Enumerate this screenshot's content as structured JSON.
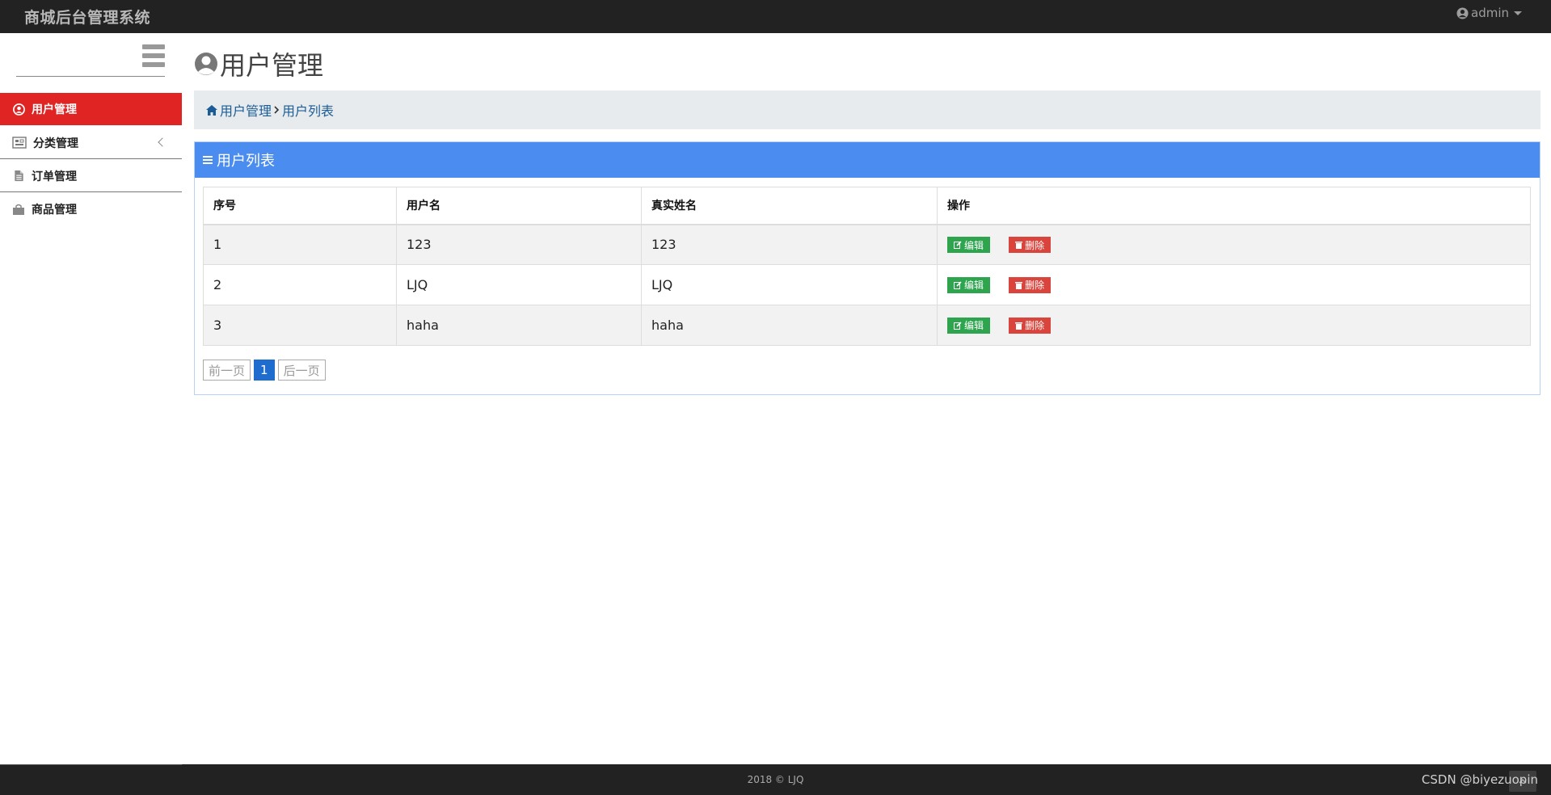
{
  "app": {
    "brand": "商城后台管理系统",
    "user": "admin"
  },
  "sidebar": {
    "items": [
      {
        "label": "用户管理",
        "icon": "user-circle-icon",
        "active": true
      },
      {
        "label": "分类管理",
        "icon": "category-icon",
        "has_submenu": true
      },
      {
        "label": "订单管理",
        "icon": "document-icon"
      },
      {
        "label": "商品管理",
        "icon": "shopping-bag-icon"
      }
    ]
  },
  "page": {
    "title": "用户管理",
    "breadcrumb": [
      "用户管理",
      "用户列表"
    ]
  },
  "panel": {
    "title": "用户列表",
    "columns": [
      "序号",
      "用户名",
      "真实姓名",
      "操作"
    ],
    "rows": [
      {
        "id": "1",
        "username": "123",
        "realname": "123"
      },
      {
        "id": "2",
        "username": "LJQ",
        "realname": "LJQ"
      },
      {
        "id": "3",
        "username": "haha",
        "realname": "haha"
      }
    ],
    "edit_label": "编辑",
    "delete_label": "删除"
  },
  "pagination": {
    "prev": "前一页",
    "current": "1",
    "next": "后一页"
  },
  "footer": {
    "copyright": "2018 © LJQ",
    "watermark": "CSDN @biyezuopin"
  },
  "colors": {
    "navbar": "#222222",
    "active_menu": "#e02323",
    "panel_heading": "#4a8cf0",
    "edit_button": "#2ea44f",
    "delete_button": "#d9453d",
    "current_page": "#1f6ccf"
  }
}
